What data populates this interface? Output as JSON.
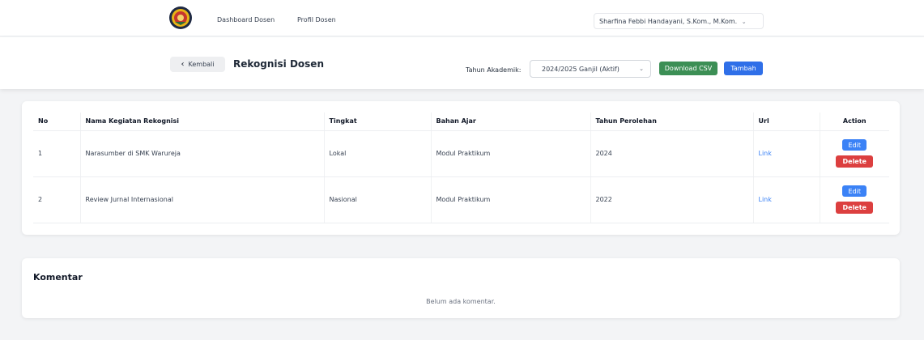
{
  "nav": {
    "dashboard": "Dashboard Dosen",
    "profil": "Profil Dosen",
    "user": "Sharfina Febbi Handayani, S.Kom., M.Kom."
  },
  "header": {
    "back": "Kembali",
    "title": "Rekognisi Dosen",
    "tahun_label": "Tahun Akademik:",
    "tahun_value": "2024/2025 Ganjil (Aktif)",
    "download_csv": "Download CSV",
    "tambah": "Tambah"
  },
  "table": {
    "columns": [
      "No",
      "Nama Kegiatan Rekognisi",
      "Tingkat",
      "Bahan Ajar",
      "Tahun Perolehan",
      "Url",
      "Action"
    ],
    "rows": [
      {
        "no": "1",
        "nama": "Narasumber di SMK Warureja",
        "tingkat": "Lokal",
        "bahan": "Modul Praktikum",
        "tahun": "2024",
        "url": "Link"
      },
      {
        "no": "2",
        "nama": "Review Jurnal Internasional",
        "tingkat": "Nasional",
        "bahan": "Modul Praktikum",
        "tahun": "2022",
        "url": "Link"
      }
    ],
    "edit": "Edit",
    "delete": "Delete"
  },
  "komentar": {
    "title": "Komentar",
    "empty": "Belum ada komentar."
  },
  "colors": {
    "csv": "#3c8f55",
    "primary": "#2f6fe8",
    "edit": "#3b82f6",
    "delete": "#dc3f3f",
    "link": "#3b82f6"
  }
}
